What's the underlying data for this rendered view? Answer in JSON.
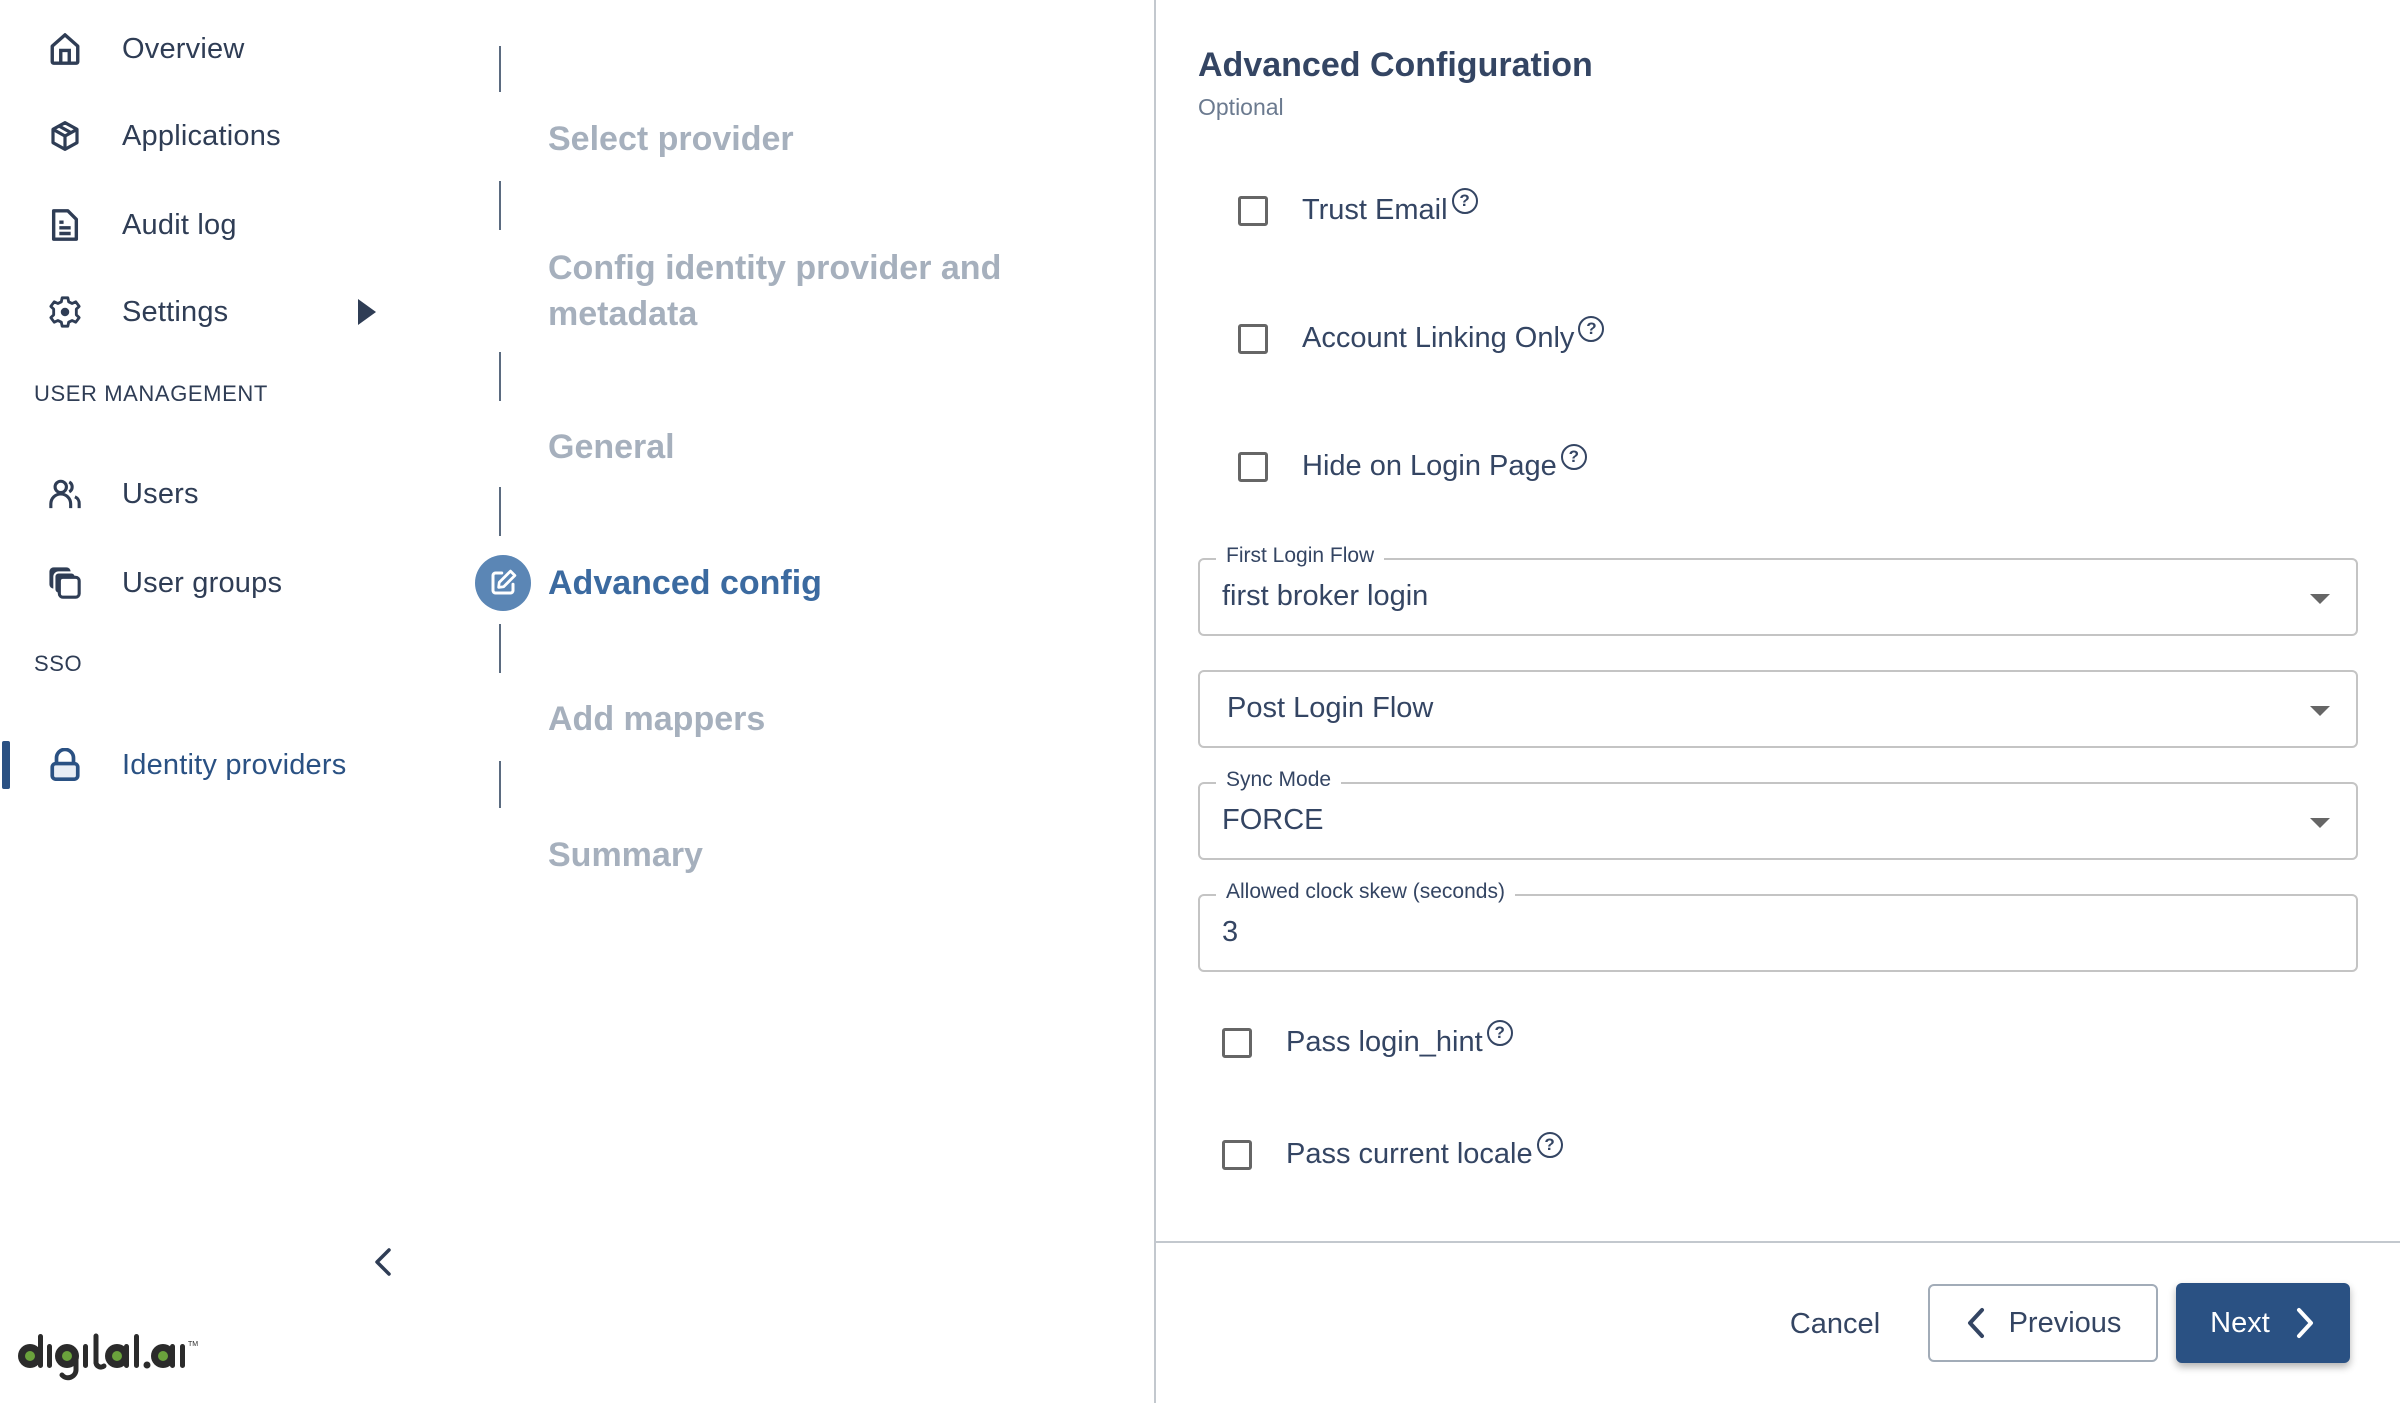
{
  "sidebar": {
    "items": [
      {
        "label": "Overview",
        "icon": "home-icon"
      },
      {
        "label": "Applications",
        "icon": "package-icon"
      },
      {
        "label": "Audit log",
        "icon": "document-icon"
      },
      {
        "label": "Settings",
        "icon": "gear-icon"
      }
    ],
    "sections": [
      {
        "heading": "USER MANAGEMENT",
        "items": [
          {
            "label": "Users",
            "icon": "users-icon"
          },
          {
            "label": "User groups",
            "icon": "user-groups-icon"
          }
        ]
      },
      {
        "heading": "SSO",
        "items": [
          {
            "label": "Identity providers",
            "icon": "lock-icon",
            "active": true
          }
        ]
      }
    ],
    "collapse_icon": "chevron-left-icon",
    "logo_text": "digital.ai",
    "logo_tm": "TM",
    "accent_color": "#2a5183",
    "logo_dot_color": "#6aa23c"
  },
  "stepper": {
    "steps": [
      {
        "label": "Select provider",
        "state": "inactive"
      },
      {
        "label": "Config identity provider and metadata",
        "state": "inactive"
      },
      {
        "label": "General",
        "state": "inactive"
      },
      {
        "label": "Advanced config",
        "state": "active",
        "icon": "edit-icon"
      },
      {
        "label": "Add mappers",
        "state": "inactive"
      },
      {
        "label": "Summary",
        "state": "inactive"
      }
    ]
  },
  "form": {
    "title": "Advanced Configuration",
    "subtitle": "Optional",
    "top_checkboxes": [
      {
        "label": "Trust Email",
        "checked": false,
        "help": true
      },
      {
        "label": "Account Linking Only",
        "checked": false,
        "help": true
      },
      {
        "label": "Hide on Login Page",
        "checked": false,
        "help": true
      }
    ],
    "fields": {
      "first_login_flow": {
        "label": "First Login Flow",
        "value": "first broker login",
        "type": "select"
      },
      "post_login_flow": {
        "placeholder": "Post Login Flow",
        "value": "",
        "type": "select"
      },
      "sync_mode": {
        "label": "Sync Mode",
        "value": "FORCE",
        "type": "select"
      },
      "clock_skew": {
        "label": "Allowed clock skew (seconds)",
        "value": "3",
        "type": "number"
      }
    },
    "bottom_checkboxes": [
      {
        "label": "Pass login_hint",
        "checked": false,
        "help": true
      },
      {
        "label": "Pass current locale",
        "checked": false,
        "help": true
      }
    ],
    "help_glyph": "?"
  },
  "footer": {
    "cancel_label": "Cancel",
    "previous_label": "Previous",
    "next_label": "Next",
    "primary_color": "#2a5183"
  }
}
